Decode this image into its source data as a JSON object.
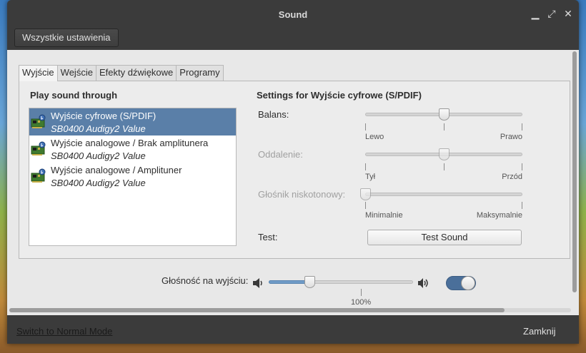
{
  "window": {
    "title": "Sound",
    "controls": {
      "minimize": "▁",
      "maximize": "⤢",
      "close": "✕"
    },
    "all_settings_button": "Wszystkie ustawienia"
  },
  "tabs": [
    {
      "label": "Wyjście",
      "active": true
    },
    {
      "label": "Wejście",
      "active": false
    },
    {
      "label": "Efekty dźwiękowe",
      "active": false
    },
    {
      "label": "Programy",
      "active": false
    }
  ],
  "output": {
    "play_through_title": "Play sound through",
    "devices": [
      {
        "name": "Wyjście cyfrowe (S/PDIF)",
        "card": "SB0400 Audigy2 Value",
        "selected": true,
        "icon": "sound-card-icon"
      },
      {
        "name": "Wyjście analogowe / Brak amplitunera",
        "card": "SB0400 Audigy2 Value",
        "selected": false,
        "icon": "sound-card-icon"
      },
      {
        "name": "Wyjście analogowe / Amplituner",
        "card": "SB0400 Audigy2 Value",
        "selected": false,
        "icon": "sound-card-icon"
      }
    ],
    "settings_title": "Settings for Wyjście cyfrowe (S/PDIF)",
    "balance": {
      "label": "Balans:",
      "min_label": "Lewo",
      "max_label": "Prawo",
      "value": 0.5,
      "enabled": true
    },
    "fade": {
      "label": "Oddalenie:",
      "min_label": "Tył",
      "max_label": "Przód",
      "value": 0.5,
      "enabled": false
    },
    "subwoofer": {
      "label": "Głośnik niskotonowy:",
      "min_label": "Minimalnie",
      "max_label": "Maksymalnie",
      "value": 0.0,
      "enabled": false
    },
    "test": {
      "label": "Test:",
      "button": "Test Sound"
    }
  },
  "volume": {
    "label": "Głośność na wyjściu:",
    "value": 0.28,
    "mark_label": "100%",
    "mark_position": 0.64,
    "muted": false,
    "switch_on": true
  },
  "footer": {
    "mode_link": "Switch to Normal Mode",
    "close_button": "Zamknij"
  },
  "colors": {
    "selection": "#5a7fa8",
    "accent": "#4a6f9a",
    "titlebar": "#3b3b3b"
  }
}
